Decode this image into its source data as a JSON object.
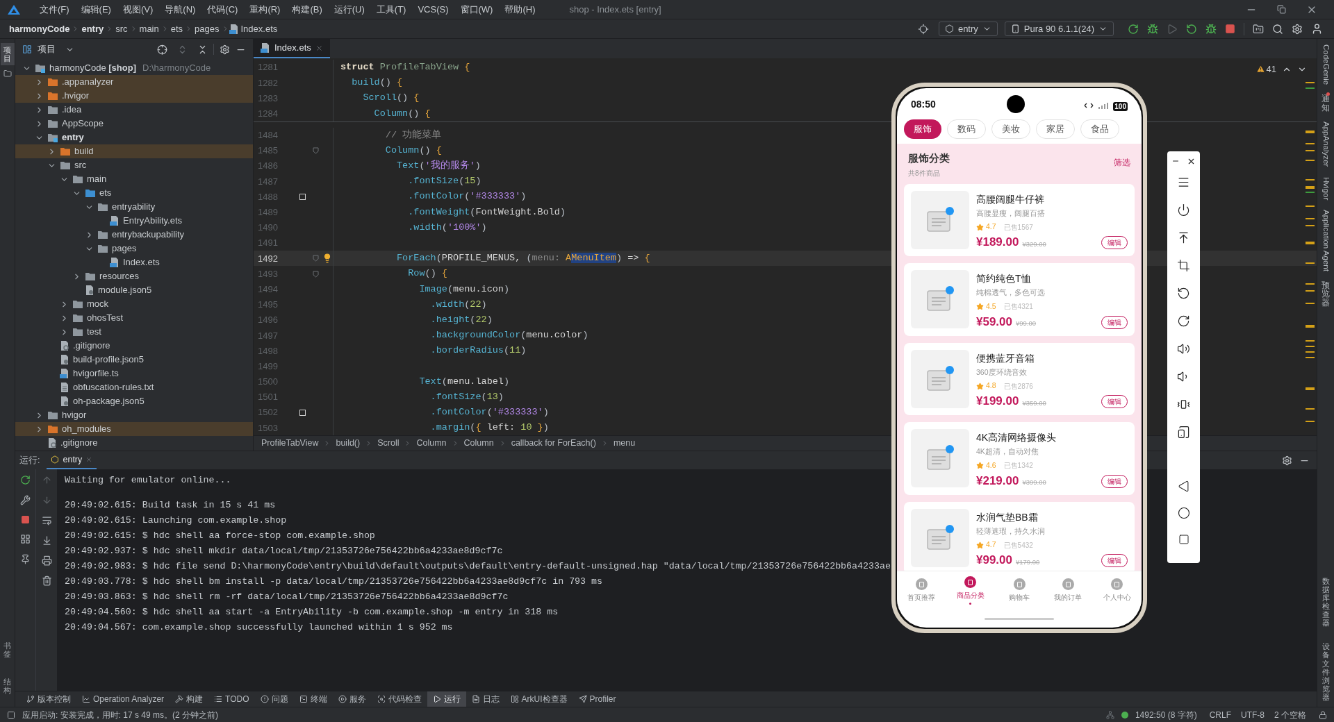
{
  "menu": [
    "文件(F)",
    "编辑(E)",
    "视图(V)",
    "导航(N)",
    "代码(C)",
    "重构(R)",
    "构建(B)",
    "运行(U)",
    "工具(T)",
    "VCS(S)",
    "窗口(W)",
    "帮助(H)"
  ],
  "window": {
    "title": "shop - Index.ets [entry]"
  },
  "breadcrumb": [
    {
      "label": "harmonyCode",
      "bold": true
    },
    {
      "label": "entry",
      "bold": true
    },
    {
      "label": "src",
      "bold": false
    },
    {
      "label": "main",
      "bold": false
    },
    {
      "label": "ets",
      "bold": false
    },
    {
      "label": "pages",
      "bold": false
    },
    {
      "label": "Index.ets",
      "bold": false
    }
  ],
  "toolbar": {
    "run_config": "entry",
    "device": "Pura 90 6.1.1(24)"
  },
  "left_tools": [
    {
      "label": "项目",
      "selected": true
    }
  ],
  "left_tools_bottom": [
    {
      "label": "书签",
      "selected": false
    },
    {
      "label": "结构",
      "selected": false
    }
  ],
  "project": {
    "title": "项目",
    "tree": [
      {
        "label": "harmonyCode",
        "tag": "[shop]",
        "path": "D:\\harmonyCode",
        "kind": "project",
        "expanded": true,
        "excluded": false,
        "children": [
          {
            "label": ".appanalyzer",
            "kind": "folder",
            "expanded": false,
            "excluded": true
          },
          {
            "label": ".hvigor",
            "kind": "folder",
            "expanded": false,
            "excluded": true
          },
          {
            "label": ".idea",
            "kind": "folder",
            "expanded": false,
            "excluded": false
          },
          {
            "label": "AppScope",
            "kind": "folder",
            "expanded": false,
            "excluded": false
          },
          {
            "label": "entry",
            "kind": "module",
            "expanded": true,
            "excluded": false,
            "children": [
              {
                "label": "build",
                "kind": "folder",
                "expanded": false,
                "excluded": true
              },
              {
                "label": "src",
                "kind": "folder",
                "expanded": true,
                "excluded": false,
                "children": [
                  {
                    "label": "main",
                    "kind": "folder",
                    "expanded": true,
                    "excluded": false,
                    "children": [
                      {
                        "label": "ets",
                        "kind": "source",
                        "expanded": true,
                        "excluded": false,
                        "children": [
                          {
                            "label": "entryability",
                            "kind": "folder",
                            "expanded": true,
                            "excluded": false,
                            "children": [
                              {
                                "label": "EntryAbility.ets",
                                "kind": "file-ets",
                                "excluded": false
                              }
                            ]
                          },
                          {
                            "label": "entrybackupability",
                            "kind": "folder",
                            "expanded": false,
                            "excluded": false
                          },
                          {
                            "label": "pages",
                            "kind": "folder",
                            "expanded": true,
                            "excluded": false,
                            "children": [
                              {
                                "label": "Index.ets",
                                "kind": "file-ets",
                                "excluded": false
                              }
                            ]
                          }
                        ]
                      },
                      {
                        "label": "resources",
                        "kind": "folder",
                        "expanded": false,
                        "excluded": false
                      },
                      {
                        "label": "module.json5",
                        "kind": "file-json",
                        "excluded": false
                      }
                    ]
                  },
                  {
                    "label": "mock",
                    "kind": "folder",
                    "expanded": false,
                    "excluded": false
                  },
                  {
                    "label": "ohosTest",
                    "kind": "folder",
                    "expanded": false,
                    "excluded": false
                  },
                  {
                    "label": "test",
                    "kind": "folder",
                    "expanded": false,
                    "excluded": false
                  }
                ]
              },
              {
                "label": ".gitignore",
                "kind": "file-git",
                "excluded": false
              },
              {
                "label": "build-profile.json5",
                "kind": "file-json",
                "excluded": false
              },
              {
                "label": "hvigorfile.ts",
                "kind": "file-ts",
                "excluded": false
              },
              {
                "label": "obfuscation-rules.txt",
                "kind": "file-txt",
                "excluded": false
              },
              {
                "label": "oh-package.json5",
                "kind": "file-json",
                "excluded": false
              }
            ]
          },
          {
            "label": "hvigor",
            "kind": "folder",
            "expanded": false,
            "excluded": false
          },
          {
            "label": "oh_modules",
            "kind": "folder",
            "expanded": false,
            "excluded": true
          },
          {
            "label": ".gitignore",
            "kind": "file-git",
            "excluded": false
          }
        ]
      }
    ]
  },
  "editor": {
    "tabs": [
      {
        "label": "Index.ets",
        "selected": true
      }
    ],
    "warnings": "41",
    "sticky_lines": [
      {
        "n": "1281",
        "fold": false,
        "bookmark": false,
        "intention": false,
        "current": false,
        "tokens": [
          {
            "kind": "kw",
            "text": "struct"
          },
          {
            "kind": "cls",
            "text": " ProfileTabView"
          },
          {
            "kind": "br",
            "text": " {"
          }
        ]
      },
      {
        "n": "1282",
        "fold": false,
        "bookmark": false,
        "intention": false,
        "current": false,
        "tokens": [
          {
            "kind": "fn",
            "text": "  build"
          },
          {
            "kind": "pn",
            "text": "()"
          },
          {
            "kind": "br",
            "text": " {"
          }
        ]
      },
      {
        "n": "1283",
        "fold": false,
        "bookmark": false,
        "intention": false,
        "current": false,
        "tokens": [
          {
            "kind": "fn",
            "text": "    Scroll"
          },
          {
            "kind": "pn",
            "text": "()"
          },
          {
            "kind": "br",
            "text": " {"
          }
        ]
      },
      {
        "n": "1284",
        "fold": false,
        "bookmark": false,
        "intention": false,
        "current": false,
        "tokens": [
          {
            "kind": "fn",
            "text": "      Column"
          },
          {
            "kind": "pn",
            "text": "()"
          },
          {
            "kind": "br",
            "text": " {"
          }
        ]
      }
    ],
    "lines": [
      {
        "n": "1484",
        "fold": false,
        "bookmark": false,
        "intention": false,
        "current": false,
        "tokens": [
          {
            "kind": "cm",
            "text": "        // 功能菜单"
          }
        ]
      },
      {
        "n": "1485",
        "fold": true,
        "bookmark": false,
        "intention": false,
        "current": false,
        "tokens": [
          {
            "kind": "fn",
            "text": "        Column"
          },
          {
            "kind": "pn",
            "text": "()"
          },
          {
            "kind": "br",
            "text": " {"
          }
        ]
      },
      {
        "n": "1486",
        "fold": false,
        "bookmark": false,
        "intention": false,
        "current": false,
        "tokens": [
          {
            "kind": "fn",
            "text": "          Text"
          },
          {
            "kind": "pn",
            "text": "("
          },
          {
            "kind": "str",
            "text": "'我的服务'"
          },
          {
            "kind": "pn",
            "text": ")"
          }
        ]
      },
      {
        "n": "1487",
        "fold": false,
        "bookmark": false,
        "intention": false,
        "current": false,
        "tokens": [
          {
            "kind": "fn",
            "text": "            .fontSize"
          },
          {
            "kind": "pn",
            "text": "("
          },
          {
            "kind": "num",
            "text": "15"
          },
          {
            "kind": "pn",
            "text": ")"
          }
        ]
      },
      {
        "n": "1488",
        "fold": false,
        "bookmark": true,
        "intention": false,
        "current": false,
        "tokens": [
          {
            "kind": "fn",
            "text": "            .fontColor"
          },
          {
            "kind": "pn",
            "text": "("
          },
          {
            "kind": "str",
            "text": "'#333333'"
          },
          {
            "kind": "pn",
            "text": ")"
          }
        ]
      },
      {
        "n": "1489",
        "fold": false,
        "bookmark": false,
        "intention": false,
        "current": false,
        "tokens": [
          {
            "kind": "fn",
            "text": "            .fontWeight"
          },
          {
            "kind": "pn",
            "text": "("
          },
          {
            "kind": "pl",
            "text": "FontWeight.Bold"
          },
          {
            "kind": "pn",
            "text": ")"
          }
        ]
      },
      {
        "n": "1490",
        "fold": false,
        "bookmark": false,
        "intention": false,
        "current": false,
        "tokens": [
          {
            "kind": "fn",
            "text": "            .width"
          },
          {
            "kind": "pn",
            "text": "("
          },
          {
            "kind": "str",
            "text": "'100%'"
          },
          {
            "kind": "pn",
            "text": ")"
          }
        ]
      },
      {
        "n": "1491",
        "fold": false,
        "bookmark": false,
        "intention": false,
        "current": false
      },
      {
        "n": "1492",
        "fold": true,
        "bookmark": false,
        "intention": true,
        "current": true,
        "tokens": [
          {
            "kind": "fn",
            "text": "          ForEach"
          },
          {
            "kind": "pn",
            "text": "("
          },
          {
            "kind": "pl",
            "text": "PROFILE_MENUS, "
          },
          {
            "kind": "pn",
            "text": "("
          },
          {
            "kind": "param",
            "text": "menu: "
          },
          {
            "kind": "type",
            "text": "A"
          },
          {
            "kind": "sel",
            "text": "MenuItem"
          },
          {
            "kind": "pn",
            "text": ")"
          },
          {
            "kind": "pl",
            "text": " => "
          },
          {
            "kind": "br",
            "text": "{"
          }
        ]
      },
      {
        "n": "1493",
        "fold": true,
        "bookmark": false,
        "intention": false,
        "current": false,
        "tokens": [
          {
            "kind": "fn",
            "text": "            Row"
          },
          {
            "kind": "pn",
            "text": "()"
          },
          {
            "kind": "br",
            "text": " {"
          }
        ]
      },
      {
        "n": "1494",
        "fold": false,
        "bookmark": false,
        "intention": false,
        "current": false,
        "tokens": [
          {
            "kind": "fn",
            "text": "              Image"
          },
          {
            "kind": "pn",
            "text": "("
          },
          {
            "kind": "pl",
            "text": "menu.icon"
          },
          {
            "kind": "pn",
            "text": ")"
          }
        ]
      },
      {
        "n": "1495",
        "fold": false,
        "bookmark": false,
        "intention": false,
        "current": false,
        "tokens": [
          {
            "kind": "fn",
            "text": "                .width"
          },
          {
            "kind": "pn",
            "text": "("
          },
          {
            "kind": "num",
            "text": "22"
          },
          {
            "kind": "pn",
            "text": ")"
          }
        ]
      },
      {
        "n": "1496",
        "fold": false,
        "bookmark": false,
        "intention": false,
        "current": false,
        "tokens": [
          {
            "kind": "fn",
            "text": "                .height"
          },
          {
            "kind": "pn",
            "text": "("
          },
          {
            "kind": "num",
            "text": "22"
          },
          {
            "kind": "pn",
            "text": ")"
          }
        ]
      },
      {
        "n": "1497",
        "fold": false,
        "bookmark": false,
        "intention": false,
        "current": false,
        "tokens": [
          {
            "kind": "fn",
            "text": "                .backgroundColor"
          },
          {
            "kind": "pn",
            "text": "("
          },
          {
            "kind": "pl",
            "text": "menu.color"
          },
          {
            "kind": "pn",
            "text": ")"
          }
        ]
      },
      {
        "n": "1498",
        "fold": false,
        "bookmark": false,
        "intention": false,
        "current": false,
        "tokens": [
          {
            "kind": "fn",
            "text": "                .borderRadius"
          },
          {
            "kind": "pn",
            "text": "("
          },
          {
            "kind": "num",
            "text": "11"
          },
          {
            "kind": "pn",
            "text": ")"
          }
        ]
      },
      {
        "n": "1499",
        "fold": false,
        "bookmark": false,
        "intention": false,
        "current": false
      },
      {
        "n": "1500",
        "fold": false,
        "bookmark": false,
        "intention": false,
        "current": false,
        "tokens": [
          {
            "kind": "fn",
            "text": "              Text"
          },
          {
            "kind": "pn",
            "text": "("
          },
          {
            "kind": "pl",
            "text": "menu.label"
          },
          {
            "kind": "pn",
            "text": ")"
          }
        ]
      },
      {
        "n": "1501",
        "fold": false,
        "bookmark": false,
        "intention": false,
        "current": false,
        "tokens": [
          {
            "kind": "fn",
            "text": "                .fontSize"
          },
          {
            "kind": "pn",
            "text": "("
          },
          {
            "kind": "num",
            "text": "13"
          },
          {
            "kind": "pn",
            "text": ")"
          }
        ]
      },
      {
        "n": "1502",
        "fold": false,
        "bookmark": true,
        "intention": false,
        "current": false,
        "tokens": [
          {
            "kind": "fn",
            "text": "                .fontColor"
          },
          {
            "kind": "pn",
            "text": "("
          },
          {
            "kind": "str",
            "text": "'#333333'"
          },
          {
            "kind": "pn",
            "text": ")"
          }
        ]
      },
      {
        "n": "1503",
        "fold": false,
        "bookmark": false,
        "intention": false,
        "current": false,
        "tokens": [
          {
            "kind": "fn",
            "text": "                .margin"
          },
          {
            "kind": "pn",
            "text": "("
          },
          {
            "kind": "br",
            "text": "{"
          },
          {
            "kind": "pl",
            "text": " left: "
          },
          {
            "kind": "num",
            "text": "10"
          },
          {
            "kind": "br",
            "text": " }"
          },
          {
            "kind": "pn",
            "text": ")"
          }
        ]
      }
    ],
    "breadcrumb": [
      "ProfileTabView",
      "build()",
      "Scroll",
      "Column",
      "Column",
      "callback for ForEach()",
      "menu"
    ]
  },
  "run_panel": {
    "label": "运行:",
    "tabs": [
      {
        "label": "entry",
        "selected": true
      }
    ],
    "log": [
      "Waiting for emulator online...",
      "20:49:02.615: Build task in 15 s 41 ms",
      "20:49:02.615: Launching com.example.shop",
      "20:49:02.615: $ hdc shell aa force-stop com.example.shop",
      "20:49:02.937: $ hdc shell mkdir data/local/tmp/21353726e756422bb6a4233ae8d9cf7c",
      "20:49:02.983: $ hdc file send D:\\harmonyCode\\entry\\build\\default\\outputs\\default\\entry-default-unsigned.hap \"data/local/tmp/21353726e756422bb6a4233ae",
      "20:49:03.778: $ hdc shell bm install -p data/local/tmp/21353726e756422bb6a4233ae8d9cf7c in 793 ms",
      "20:49:03.863: $ hdc shell rm -rf data/local/tmp/21353726e756422bb6a4233ae8d9cf7c",
      "20:49:04.560: $ hdc shell aa start -a EntryAbility -b com.example.shop -m entry in 318 ms",
      "20:49:04.567: com.example.shop successfully launched within 1 s 952 ms"
    ]
  },
  "phone": {
    "time": "08:50",
    "battery": "100",
    "categories": [
      {
        "label": "服饰",
        "selected": true
      },
      {
        "label": "数码",
        "selected": false
      },
      {
        "label": "美妆",
        "selected": false
      },
      {
        "label": "家居",
        "selected": false
      },
      {
        "label": "食品",
        "selected": false
      }
    ],
    "section": {
      "title": "服饰分类",
      "count": "共8件商品",
      "filter": "筛选"
    },
    "products": [
      {
        "name": "高腰阔腿牛仔裤",
        "desc": "高腰显瘦，阔腿百搭",
        "rating": "4.7",
        "sold": "已售1567",
        "price": "¥189.00",
        "original": "¥329.00",
        "action": "编辑"
      },
      {
        "name": "简约纯色T恤",
        "desc": "纯棉透气，多色可选",
        "rating": "4.5",
        "sold": "已售4321",
        "price": "¥59.00",
        "original": "¥99.00",
        "action": "编辑"
      },
      {
        "name": "便携蓝牙音箱",
        "desc": "360度环绕音效",
        "rating": "4.8",
        "sold": "已售2876",
        "price": "¥199.00",
        "original": "¥359.00",
        "action": "编辑"
      },
      {
        "name": "4K高清网络摄像头",
        "desc": "4K超清，自动对焦",
        "rating": "4.6",
        "sold": "已售1342",
        "price": "¥219.00",
        "original": "¥399.00",
        "action": "编辑"
      },
      {
        "name": "水润气垫BB霜",
        "desc": "轻薄遮瑕，持久水润",
        "rating": "4.7",
        "sold": "已售5432",
        "price": "¥99.00",
        "original": "¥179.00",
        "action": "编辑"
      }
    ],
    "nav": [
      {
        "label": "首页推荐",
        "selected": false
      },
      {
        "label": "商品分类",
        "selected": true
      },
      {
        "label": "购物车",
        "selected": false
      },
      {
        "label": "我的订单",
        "selected": false
      },
      {
        "label": "个人中心",
        "selected": false
      }
    ]
  },
  "right_tools": [
    {
      "label": "CodeGenie",
      "kind": "rotated",
      "unread": false
    },
    {
      "label": "通知",
      "kind": "stacked",
      "unread": true
    },
    {
      "label": "AppAnalyzer",
      "kind": "rotated",
      "unread": false
    },
    {
      "label": "Hvigor",
      "kind": "rotated",
      "unread": false
    },
    {
      "label": "Application Agent",
      "kind": "rotated",
      "unread": false
    },
    {
      "label": "预览器",
      "kind": "stacked",
      "unread": false
    }
  ],
  "right_tools_bottom": [
    {
      "label": "数据库检查器",
      "kind": "stacked"
    },
    {
      "label": "设备文件浏览器",
      "kind": "stacked"
    }
  ],
  "bottom_tools": [
    {
      "label": "版本控制",
      "selected": false
    },
    {
      "label": "Operation Analyzer",
      "selected": false
    },
    {
      "label": "构建",
      "selected": false
    },
    {
      "label": "TODO",
      "selected": false
    },
    {
      "label": "问题",
      "selected": false
    },
    {
      "label": "终端",
      "selected": false
    },
    {
      "label": "服务",
      "selected": false
    },
    {
      "label": "代码检查",
      "selected": false
    },
    {
      "label": "运行",
      "selected": true
    },
    {
      "label": "日志",
      "selected": false
    },
    {
      "label": "ArkUI检查器",
      "selected": false
    },
    {
      "label": "Profiler",
      "selected": false
    }
  ],
  "status_bar": {
    "message": "应用启动: 安装完成，用时: 17 s 49 ms。(2 分钟之前)",
    "position": "1492:50 (8 字符)",
    "line_separator": "CRLF",
    "encoding": "UTF-8",
    "indent": "2 个空格"
  }
}
